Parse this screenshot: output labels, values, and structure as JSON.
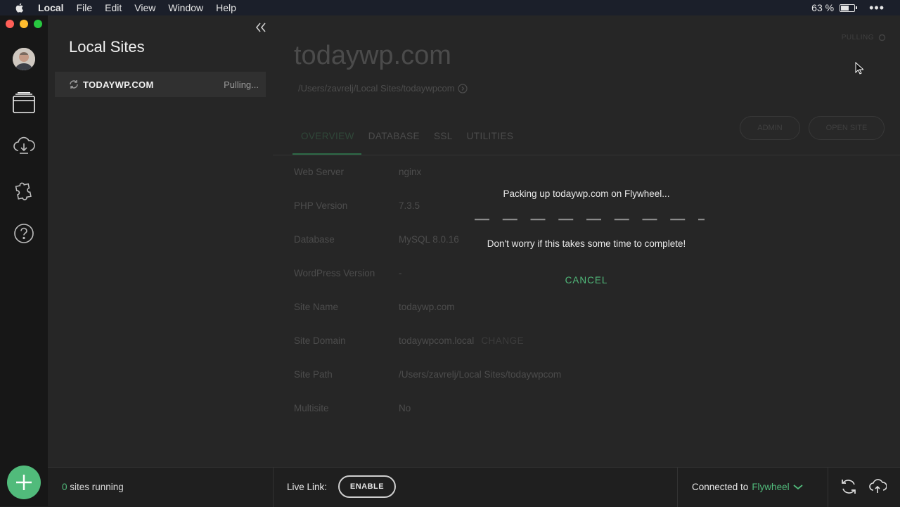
{
  "menubar": {
    "app_name": "Local",
    "items": [
      "File",
      "Edit",
      "View",
      "Window",
      "Help"
    ],
    "battery_percent": "63 %",
    "battery_level": 0.63
  },
  "sidebar": {
    "title": "Local Sites",
    "sites": [
      {
        "name": "TODAYWP.COM",
        "status": "Pulling..."
      }
    ]
  },
  "site": {
    "title": "todaywp.com",
    "path": "/Users/zavrelj/Local Sites/todaywpcom",
    "sync_status": "PULLING",
    "admin_label": "ADMIN",
    "open_site_label": "OPEN SITE",
    "tabs": [
      "OVERVIEW",
      "DATABASE",
      "SSL",
      "UTILITIES"
    ],
    "active_tab": "OVERVIEW",
    "info": [
      {
        "label": "Web Server",
        "value": "nginx"
      },
      {
        "label": "PHP Version",
        "value": "7.3.5"
      },
      {
        "label": "Database",
        "value": "MySQL 8.0.16"
      },
      {
        "label": "WordPress Version",
        "value": "-"
      },
      {
        "label": "Site Name",
        "value": "todaywp.com"
      },
      {
        "label": "Site Domain",
        "value": "todaywpcom.local",
        "action": "CHANGE"
      },
      {
        "label": "Site Path",
        "value": "/Users/zavrelj/Local Sites/todaywpcom"
      },
      {
        "label": "Multisite",
        "value": "No"
      }
    ]
  },
  "overlay": {
    "message": "Packing up todaywp.com on Flywheel...",
    "sub_message": "Don't worry if this takes some time to complete!",
    "cancel_label": "CANCEL"
  },
  "footer": {
    "sites_running_count": "0",
    "sites_running_label": " sites running",
    "live_link_label": "Live Link:",
    "enable_label": "ENABLE",
    "connected_label": "Connected to",
    "provider": "Flywheel"
  },
  "colors": {
    "accent": "#51bb7b",
    "close": "#ff5f57",
    "minimize": "#febc2e",
    "zoom": "#28c840"
  }
}
